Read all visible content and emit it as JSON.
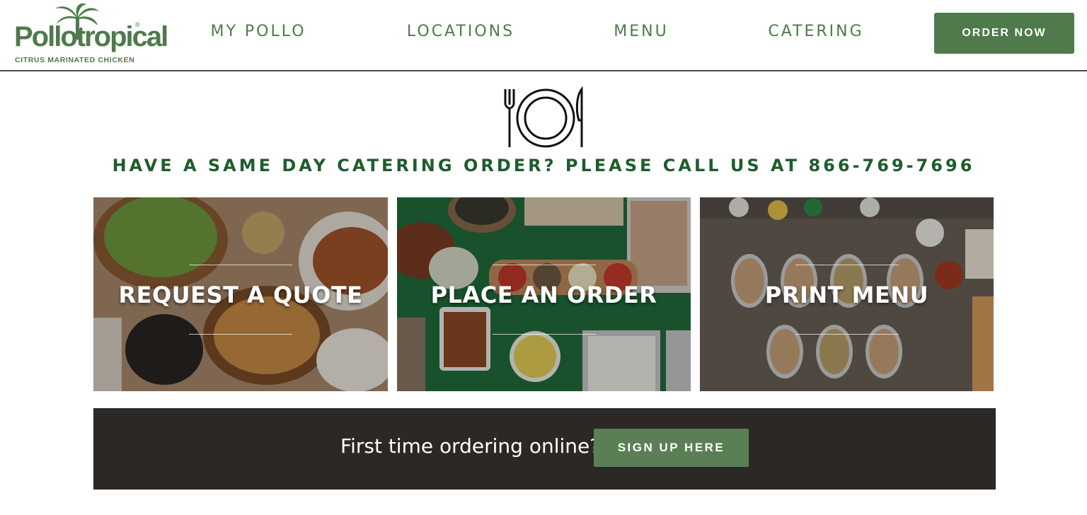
{
  "brand": {
    "logo_word": "Pollotropical",
    "logo_mark": "®",
    "tagline": "CITRUS MARINATED CHICKEN",
    "brand_color": "#4f7a4c",
    "headline_color": "#1f5c2f"
  },
  "nav": {
    "items": [
      {
        "label": "MY POLLO"
      },
      {
        "label": "LOCATIONS"
      },
      {
        "label": "MENU"
      },
      {
        "label": "CATERING"
      }
    ],
    "order_button": "ORDER NOW"
  },
  "catering": {
    "icon": "plate-fork-knife-icon",
    "headline": "HAVE A SAME DAY CATERING ORDER? PLEASE CALL US AT 866-769-7696",
    "tiles": [
      {
        "label": "REQUEST A QUOTE"
      },
      {
        "label": "PLACE AN ORDER"
      },
      {
        "label": "PRINT MENU"
      }
    ]
  },
  "signup": {
    "prompt": "First time ordering online?",
    "button": "SIGN UP HERE"
  }
}
